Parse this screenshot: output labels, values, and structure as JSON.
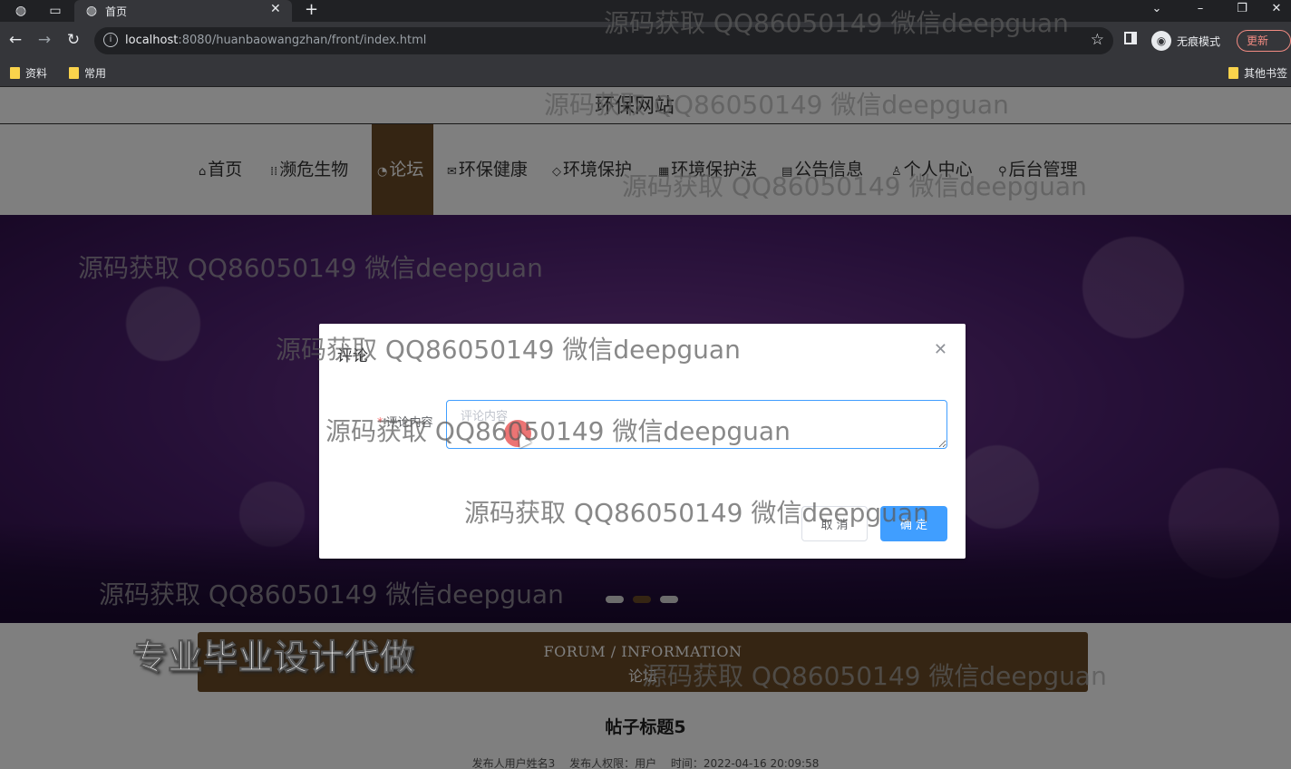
{
  "browser": {
    "tab_title": "首页",
    "url_host": "localhost",
    "url_rest": ":8080/huanbaowangzhan/front/index.html",
    "incognito_label": "无痕模式",
    "update_label": "更新",
    "bookmarks": [
      {
        "label": "资料"
      },
      {
        "label": "常用"
      },
      {
        "label": "其他书签"
      }
    ]
  },
  "site": {
    "title": "环保网站",
    "nav": [
      {
        "icon": "⌂",
        "label": "首页"
      },
      {
        "icon": "⁞⁞",
        "label": "濒危生物"
      },
      {
        "icon": "◔",
        "label": "论坛"
      },
      {
        "icon": "✉",
        "label": "环保健康"
      },
      {
        "icon": "◇",
        "label": "环境保护"
      },
      {
        "icon": "▦",
        "label": "环境保护法"
      },
      {
        "icon": "▤",
        "label": "公告信息"
      },
      {
        "icon": "♙",
        "label": "个人中心"
      },
      {
        "icon": "⚲",
        "label": "后台管理"
      }
    ],
    "active_nav": "论坛"
  },
  "section": {
    "title_en": "FORUM / INFORMATION",
    "title_cn": "论坛"
  },
  "post": {
    "title": "帖子标题5",
    "author": "发布人用户姓名3",
    "role": "发布人权限：用户",
    "time": "时间：2022-04-16 20:09:58"
  },
  "dialog": {
    "title": "评论",
    "label": "评论内容",
    "placeholder": "评论内容",
    "cancel": "取 消",
    "confirm": "确 定"
  },
  "overlay_text": {
    "watermark": "源码获取 QQ86050149 微信deepguan",
    "slogan": "专业毕业设计代做"
  },
  "colors": {
    "accent": "#6a4a26",
    "primary_button": "#409eff"
  }
}
